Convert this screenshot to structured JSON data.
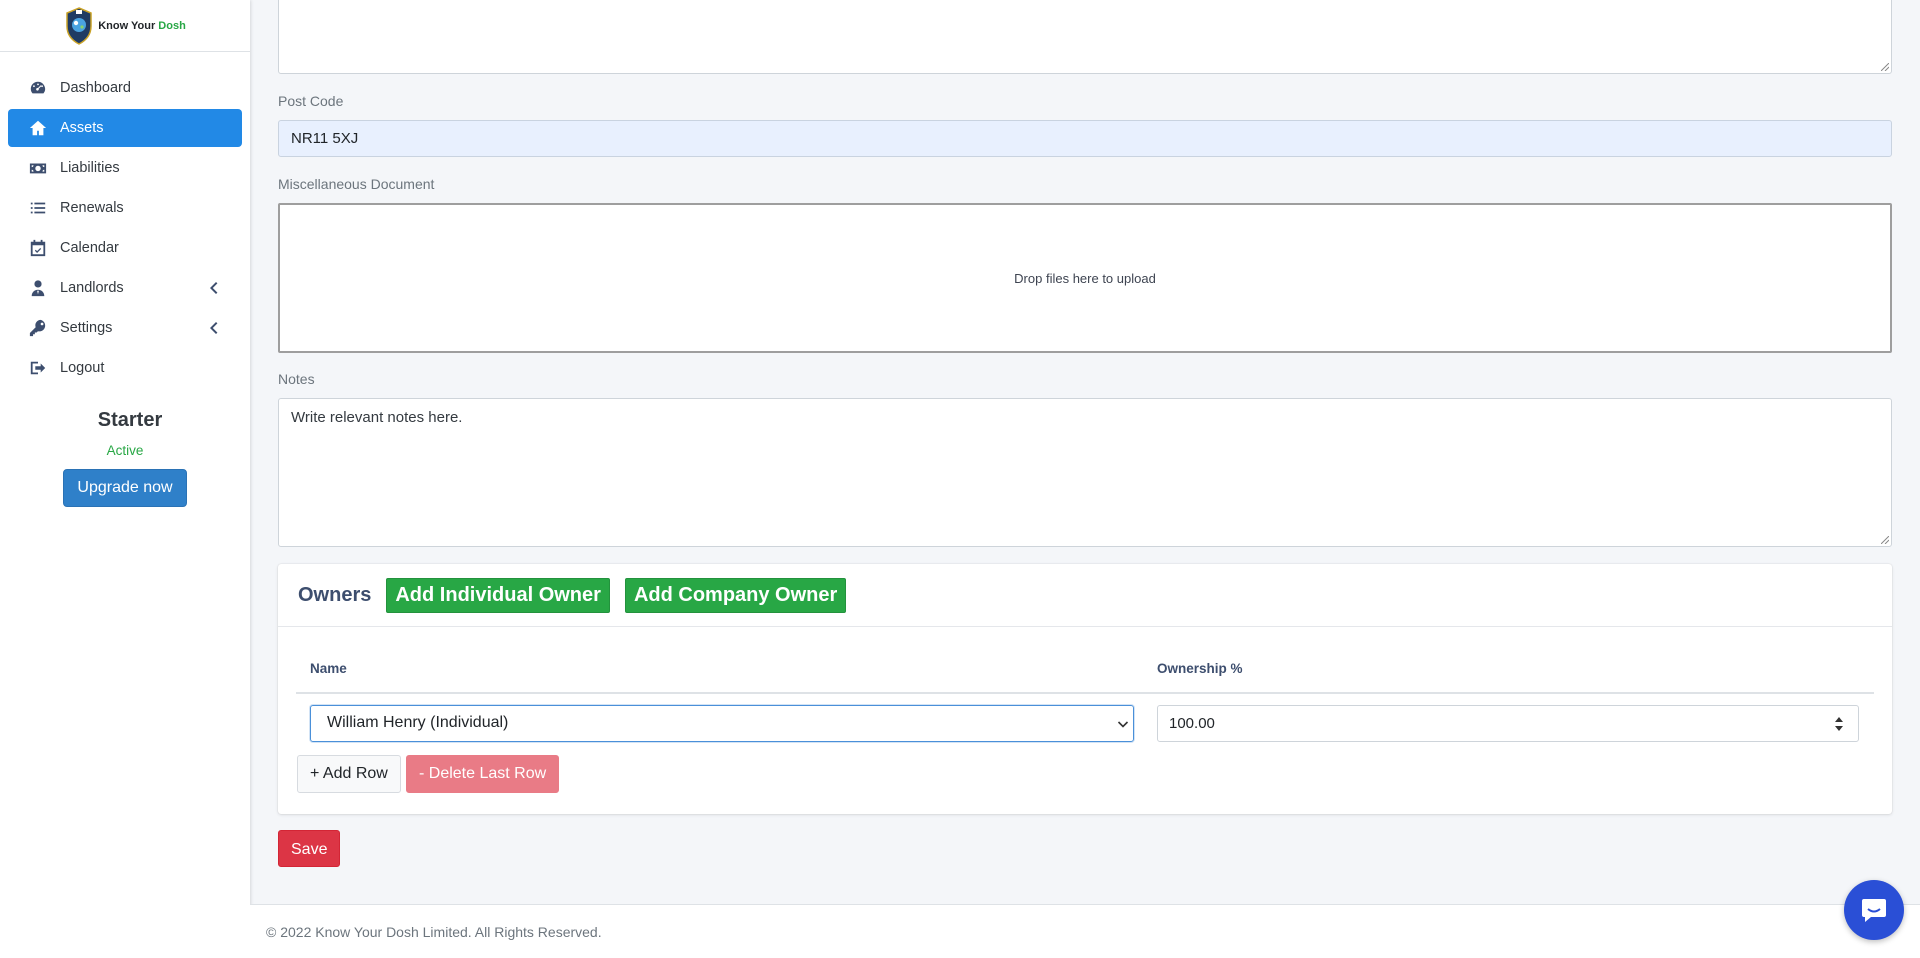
{
  "brand": {
    "name_part1": "Know Your",
    "name_part2": "Dosh"
  },
  "sidebar": {
    "items": [
      {
        "label": "Dashboard",
        "icon": "dashboard-icon"
      },
      {
        "label": "Assets",
        "icon": "home-icon",
        "active": true
      },
      {
        "label": "Liabilities",
        "icon": "money-bill-icon"
      },
      {
        "label": "Renewals",
        "icon": "list-icon"
      },
      {
        "label": "Calendar",
        "icon": "calendar-check-icon"
      },
      {
        "label": "Landlords",
        "icon": "user-tie-icon",
        "expandable": true
      },
      {
        "label": "Settings",
        "icon": "key-icon",
        "expandable": true
      },
      {
        "label": "Logout",
        "icon": "sign-out-icon"
      }
    ],
    "plan": {
      "name": "Starter",
      "status": "Active",
      "upgrade_label": "Upgrade now"
    }
  },
  "form": {
    "postcode": {
      "label": "Post Code",
      "value": "NR11 5XJ"
    },
    "misc_doc": {
      "label": "Miscellaneous Document",
      "dropzone_text": "Drop files here to upload"
    },
    "notes": {
      "label": "Notes",
      "value": "Write relevant notes here."
    }
  },
  "owners": {
    "title": "Owners",
    "add_individual_label": "Add Individual Owner",
    "add_company_label": "Add Company Owner",
    "columns": [
      "Name",
      "Ownership %"
    ],
    "rows": [
      {
        "name": "William Henry (Individual)",
        "ownership": "100.00"
      }
    ],
    "add_row_label": "+ Add Row",
    "delete_row_label": "- Delete Last Row"
  },
  "save_label": "Save",
  "footer": {
    "text": "© 2022 Know Your Dosh Limited. All Rights Reserved."
  },
  "colors": {
    "primary": "#2289e6",
    "success": "#28a745",
    "danger": "#dc3545",
    "chat": "#2a4fd6"
  }
}
